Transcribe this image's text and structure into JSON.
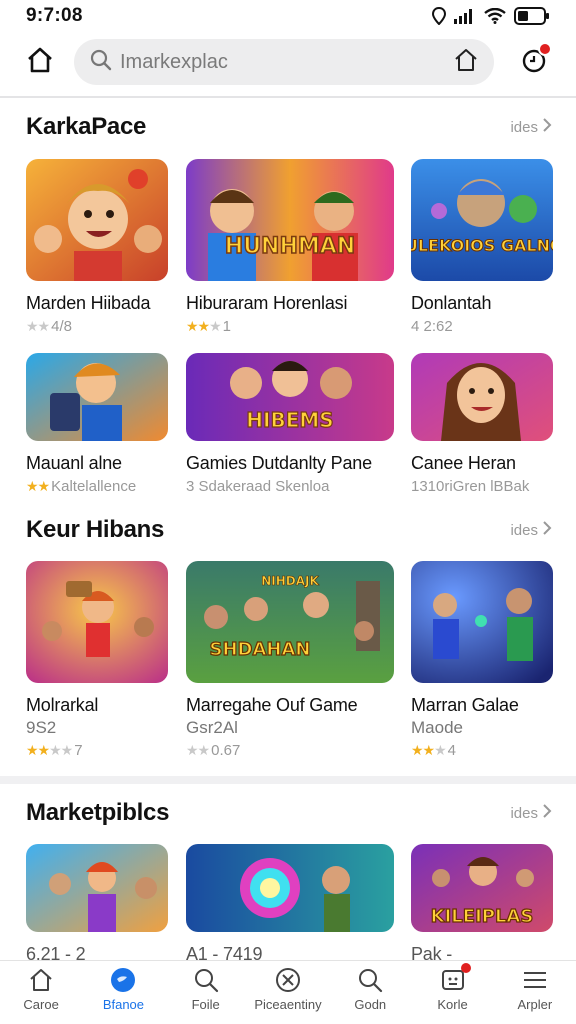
{
  "status_bar": {
    "time": "9:7:08"
  },
  "search": {
    "placeholder": "Imarkexplac"
  },
  "sections": [
    {
      "title": "KarkaPace",
      "more": "ides",
      "cards": [
        {
          "title": "Marden Hiibada",
          "rating_stars": 2,
          "rating_text": "4/8"
        },
        {
          "title": "Hiburaram Horenlasi",
          "rating_stars": 3,
          "rating_text": "1"
        },
        {
          "title": "Donlantah",
          "rating_stars": 0,
          "rating_text": "4 2:62"
        },
        {
          "title": "Mauanl alne",
          "rating_stars": 3,
          "rating_text": "Kaltelallence"
        },
        {
          "title": "Gamies Dutdanlty Pane",
          "rating_stars": 0,
          "rating_text": "3 Sdakeraad Skenloa"
        },
        {
          "title": "Canee Heran",
          "rating_stars": 0,
          "rating_text": "1310riGren lBBak"
        }
      ]
    },
    {
      "title": "Keur Hibans",
      "more": "ides",
      "cards": [
        {
          "title": "Molrarkal",
          "sub": "9S2",
          "rating_stars": 2,
          "rating_text": "7"
        },
        {
          "title": "Marregahe Ouf Game",
          "sub": "Gsr2Al",
          "rating_stars": 2,
          "rating_text": "0.67"
        },
        {
          "title": "Marran Galae",
          "sub": "Maode",
          "rating_stars": 2,
          "rating_text": "4"
        }
      ]
    },
    {
      "title": "Marketpiblcs",
      "more": "ides",
      "cards": [
        {
          "title": "6.21 - 2"
        },
        {
          "title": "A1 - 7419"
        },
        {
          "title": "Pak -"
        }
      ]
    }
  ],
  "bottom_nav": [
    {
      "label": "Caroe",
      "icon": "home-icon"
    },
    {
      "label": "Bfanoe",
      "icon": "globe-icon",
      "active": true
    },
    {
      "label": "Foile",
      "icon": "search-icon"
    },
    {
      "label": "Piceaentiny",
      "icon": "game-controller-icon"
    },
    {
      "label": "Godn",
      "icon": "search-icon"
    },
    {
      "label": "Korle",
      "icon": "inbox-icon",
      "badge": true
    },
    {
      "label": "Arpler",
      "icon": "menu-icon"
    }
  ],
  "thumb_texts": {
    "t1b": "HUNHMAN",
    "t1c": "MULEKOIOS GALNOS",
    "t2b": "HIBEMS",
    "k2": "SHDAHAN",
    "m3": "KILEIPLAS"
  },
  "colors": {
    "accent": "#1a73e8",
    "badge": "#e02020",
    "star": "#f2b01e"
  }
}
